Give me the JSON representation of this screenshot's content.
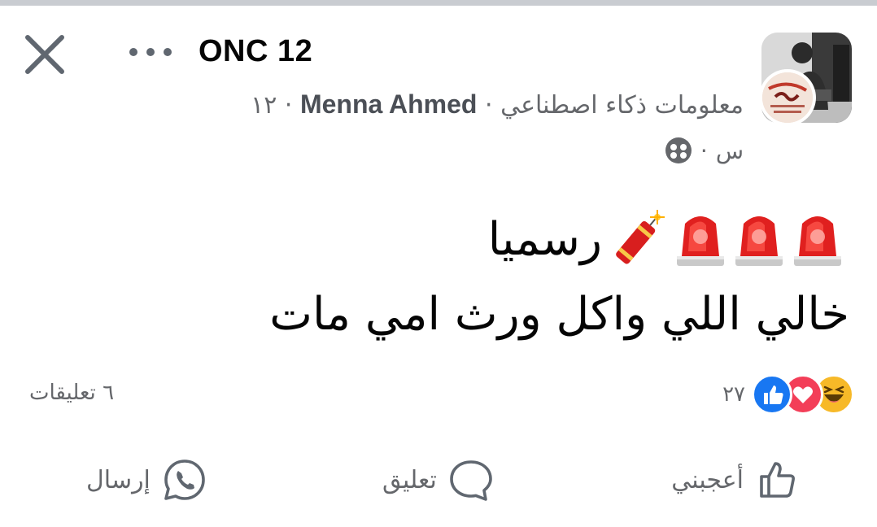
{
  "header": {
    "page_name": "ONC 12",
    "author": "Menna Ahmed",
    "group_name": "معلومات ذكاء اصطناعي",
    "sep": "·",
    "author_suffix": "١٢",
    "time": "س",
    "icons": {
      "close": "close-icon",
      "more": "more-dots-icon",
      "audience": "friends-group-icon"
    }
  },
  "post": {
    "line1": "رسميا",
    "line2": "خالي اللي واكل ورث امي مات",
    "emojis": [
      "police-light",
      "police-light",
      "police-light",
      "firecracker"
    ]
  },
  "stats": {
    "reaction_count": "٢٧",
    "comments_label": "٦ تعليقات",
    "reaction_icons": [
      "haha-icon",
      "love-icon",
      "like-icon"
    ]
  },
  "actions": {
    "like_label": "أعجبني",
    "comment_label": "تعليق",
    "send_label": "إرسال"
  },
  "colors": {
    "like_blue": "#1877f2",
    "love_red": "#f33e58",
    "haha_yellow": "#f7b928",
    "secondary_text": "#65676b",
    "siren_red": "#e0201f"
  }
}
